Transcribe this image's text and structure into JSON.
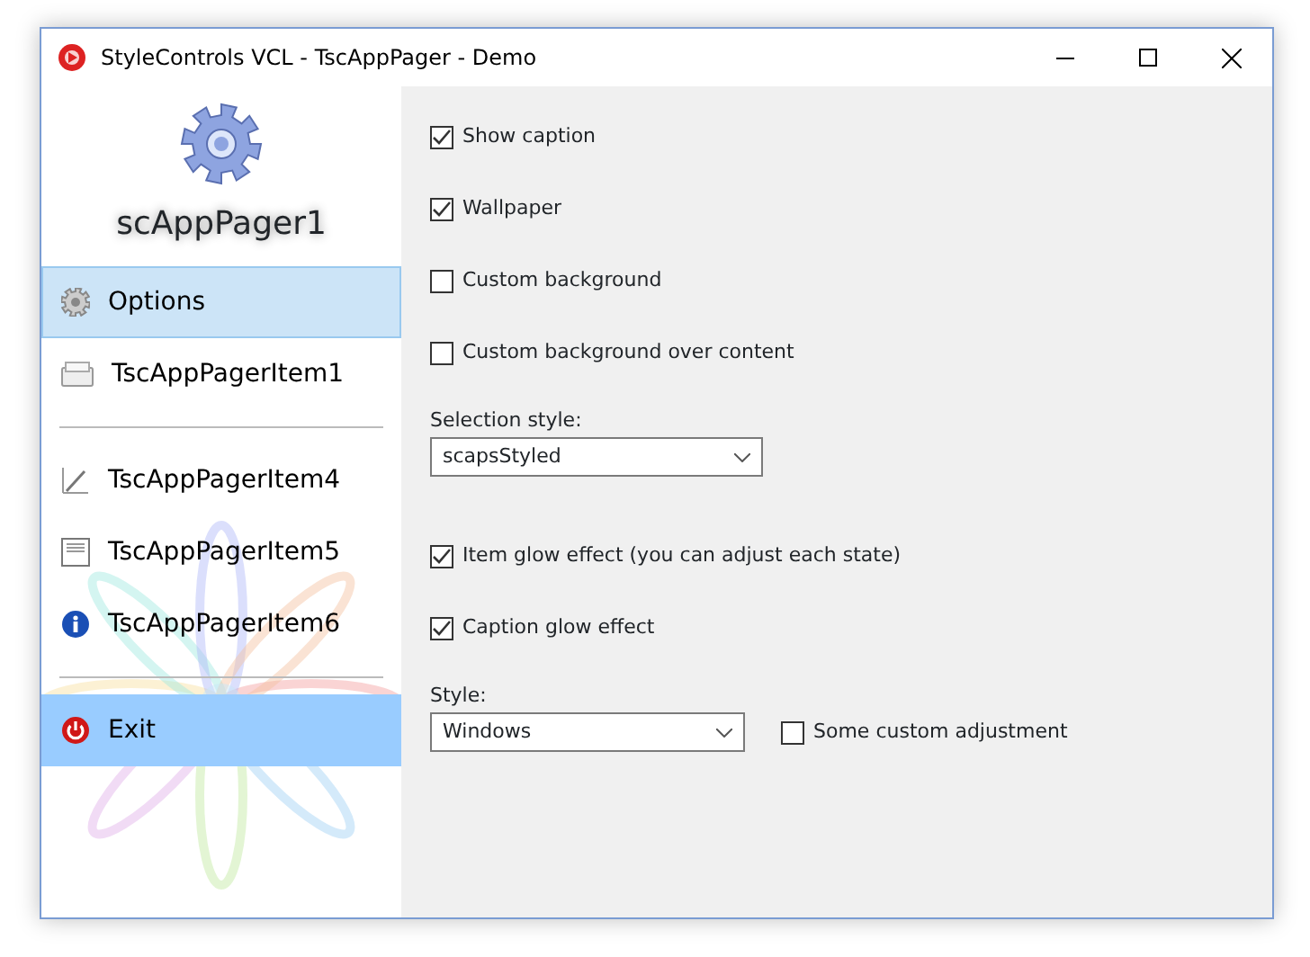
{
  "window": {
    "title": "StyleControls VCL - TscAppPager - Demo"
  },
  "pager": {
    "caption": "scAppPager1",
    "items": [
      {
        "kind": "item",
        "label": "Options",
        "selected": true,
        "highlighted": false
      },
      {
        "kind": "item",
        "label": "TscAppPagerItem1",
        "selected": false,
        "highlighted": false
      },
      {
        "kind": "divider"
      },
      {
        "kind": "item",
        "label": "TscAppPagerItem4",
        "selected": false,
        "highlighted": false
      },
      {
        "kind": "item",
        "label": "TscAppPagerItem5",
        "selected": false,
        "highlighted": false
      },
      {
        "kind": "item",
        "label": "TscAppPagerItem6",
        "selected": false,
        "highlighted": false
      },
      {
        "kind": "divider"
      },
      {
        "kind": "item",
        "label": "Exit",
        "selected": false,
        "highlighted": true
      }
    ]
  },
  "options": [
    {
      "kind": "checkbox",
      "label": "Show caption",
      "checked": true
    },
    {
      "kind": "checkbox",
      "label": "Wallpaper",
      "checked": true
    },
    {
      "kind": "checkbox",
      "label": "Custom background",
      "checked": false
    },
    {
      "kind": "checkbox",
      "label": "Custom background over content",
      "checked": false
    },
    {
      "kind": "label",
      "label": "Selection style:"
    },
    {
      "kind": "select",
      "value": "scapsStyled"
    },
    {
      "kind": "checkbox",
      "label": "Item glow effect (you can adjust each state)",
      "checked": true
    },
    {
      "kind": "checkbox",
      "label": "Caption glow effect",
      "checked": true
    },
    {
      "kind": "label",
      "label": "Style:"
    },
    {
      "kind": "select",
      "value": "Windows",
      "checkbox": {
        "label": "Some custom adjustment",
        "checked": false
      }
    }
  ]
}
